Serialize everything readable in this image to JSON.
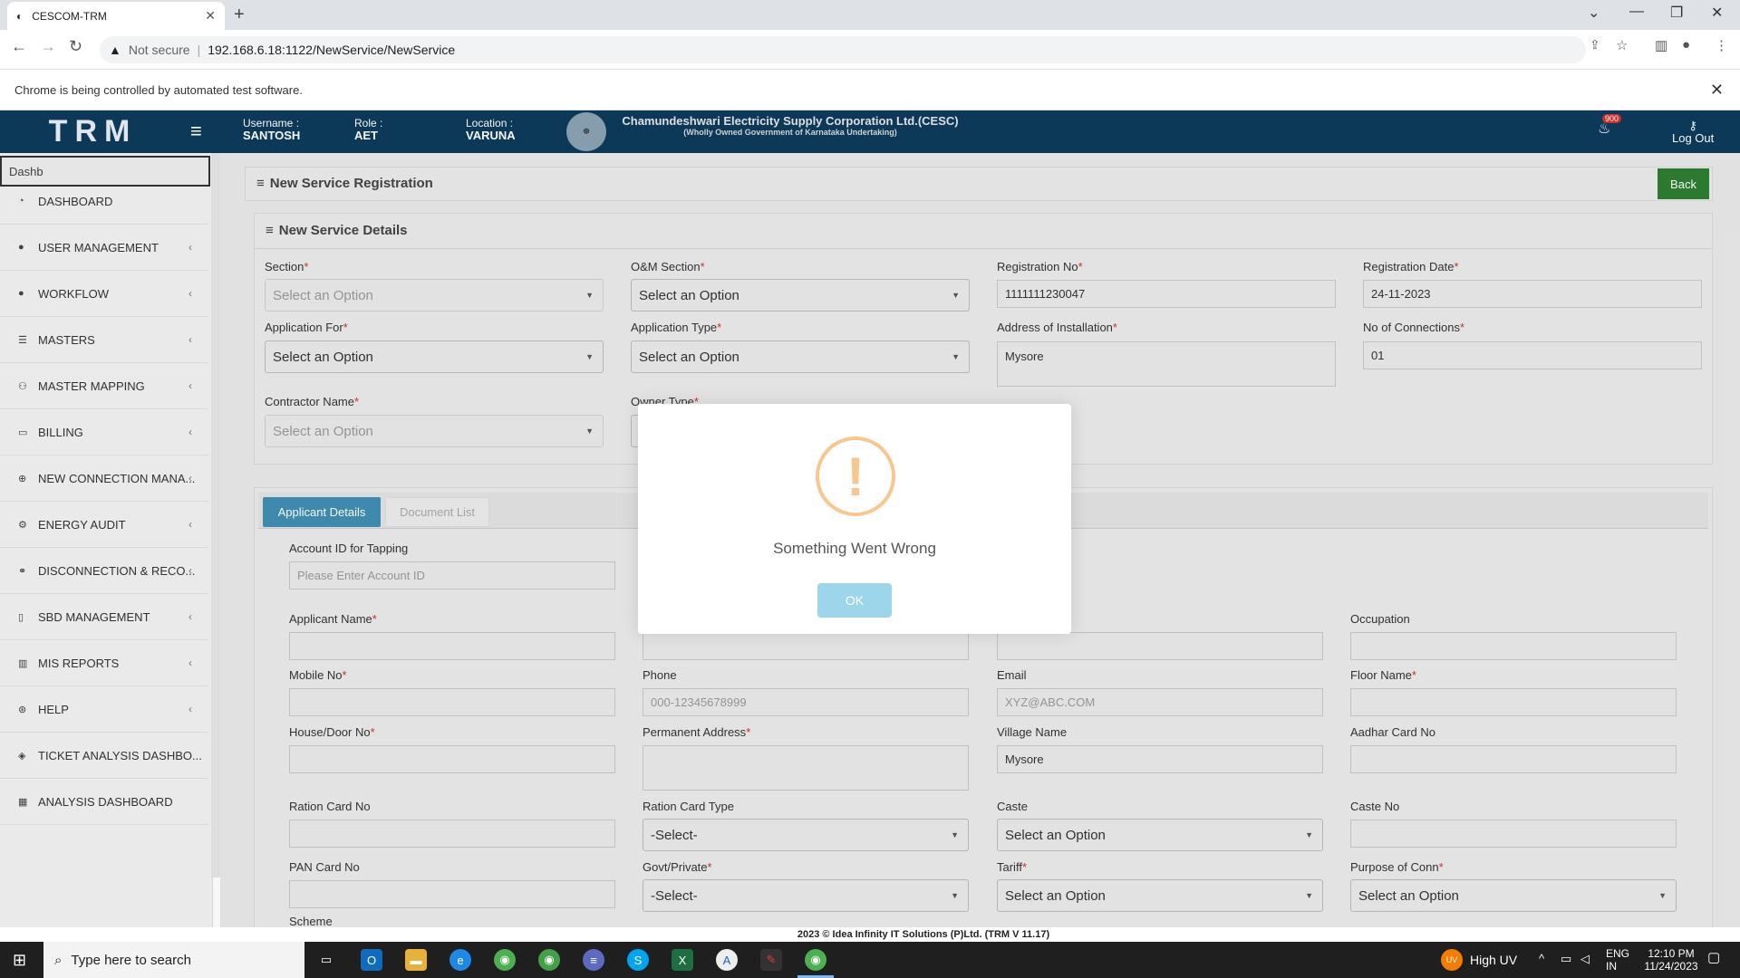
{
  "browser": {
    "tab_title": "CESCOM-TRM",
    "not_secure": "Not secure",
    "url": "192.168.6.18:1122/NewService/NewService",
    "infobar": "Chrome is being controlled by automated test software."
  },
  "header": {
    "brand": "TRM",
    "username_label": "Username :",
    "username": "SANTOSH",
    "role_label": "Role :",
    "role": "AET",
    "location_label": "Location :",
    "location": "VARUNA",
    "corp_title": "Chamundeshwari Electricity Supply Corporation Ltd.(CESC)",
    "corp_subtitle": "(Wholly Owned Government of Karnataka Undertaking)",
    "notif_count": "900",
    "logout": "Log Out"
  },
  "sidebar": {
    "search_value": "Dashb",
    "items": [
      {
        "label": "DASHBOARD",
        "icon": "dashboard-icon",
        "chev": ""
      },
      {
        "label": "USER MANAGEMENT",
        "icon": "user-icon",
        "chev": "‹"
      },
      {
        "label": "WORKFLOW",
        "icon": "user-icon",
        "chev": "‹"
      },
      {
        "label": "MASTERS",
        "icon": "list-icon",
        "chev": "‹"
      },
      {
        "label": "MASTER MAPPING",
        "icon": "sitemap-icon",
        "chev": "‹"
      },
      {
        "label": "BILLING",
        "icon": "monitor-icon",
        "chev": "‹"
      },
      {
        "label": "NEW CONNECTION MANA...",
        "icon": "plus-circle-icon",
        "chev": "‹"
      },
      {
        "label": "ENERGY AUDIT",
        "icon": "cogs-icon",
        "chev": "‹"
      },
      {
        "label": "DISCONNECTION & RECO...",
        "icon": "link-icon",
        "chev": "‹"
      },
      {
        "label": "SBD MANAGEMENT",
        "icon": "mobile-icon",
        "chev": "‹"
      },
      {
        "label": "MIS REPORTS",
        "icon": "bar-chart-icon",
        "chev": "‹"
      },
      {
        "label": "HELP",
        "icon": "help-icon",
        "chev": "‹"
      },
      {
        "label": "TICKET ANALYSIS DASHBO...",
        "icon": "ticket-icon",
        "chev": ""
      },
      {
        "label": "ANALYSIS DASHBOARD",
        "icon": "chart-icon",
        "chev": ""
      }
    ]
  },
  "page": {
    "title": "New Service Registration",
    "back": "Back",
    "details_title": "New Service Details",
    "section_label": "Section",
    "section_value": "Select an Option",
    "om_label": "O&M Section",
    "om_value": "Select an Option",
    "regno_label": "Registration No",
    "regno_value": "1111111230047",
    "regdate_label": "Registration Date",
    "regdate_value": "24-11-2023",
    "appfor_label": "Application For",
    "appfor_value": "Select an Option",
    "apptype_label": "Application Type",
    "apptype_value": "Select an Option",
    "addr_label": "Address of Installation",
    "addr_value": "Mysore",
    "noconn_label": "No of Connections",
    "noconn_value": "01",
    "contractor_label": "Contractor Name",
    "contractor_value": "Select an Option",
    "owner_label": "Owner Type"
  },
  "tabs": {
    "applicant": "Applicant Details",
    "documents": "Document List"
  },
  "applicant": {
    "accid_label": "Account ID for Tapping",
    "accid_ph": "Please Enter Account ID",
    "name_label": "Applicant Name",
    "occupation_label": "Occupation",
    "mobile_label": "Mobile No",
    "phone_label": "Phone",
    "phone_ph": "000-12345678999",
    "email_label": "Email",
    "email_ph": "XYZ@ABC.COM",
    "floor_label": "Floor Name",
    "house_label": "House/Door No",
    "perm_label": "Permanent Address",
    "village_label": "Village Name",
    "village_value": "Mysore",
    "aadhar_label": "Aadhar Card No",
    "ration_label": "Ration Card No",
    "rationtype_label": "Ration Card Type",
    "rationtype_value": "-Select-",
    "caste_label": "Caste",
    "caste_value": "Select an Option",
    "casteno_label": "Caste No",
    "pan_label": "PAN Card No",
    "govt_label": "Govt/Private",
    "govt_value": "-Select-",
    "tariff_label": "Tariff",
    "tariff_value": "Select an Option",
    "purpose_label": "Purpose of Conn",
    "purpose_value": "Select an Option",
    "scheme_label": "Scheme"
  },
  "footer": "2023 © Idea Infinity IT Solutions (P)Ltd. (TRM V 11.17)",
  "modal": {
    "message": "Something Went Wrong",
    "ok": "OK"
  },
  "taskbar": {
    "search_ph": "Type here to search",
    "weather": "High UV",
    "lang1": "ENG",
    "lang2": "IN",
    "time": "12:10 PM",
    "date": "11/24/2023"
  },
  "colors": {
    "header_bg": "#0c3b5a",
    "back_button": "#2e7d32",
    "active_tab": "#3f8fb3",
    "warning": "#f8c78f",
    "ok_button": "#9dd6eb"
  }
}
